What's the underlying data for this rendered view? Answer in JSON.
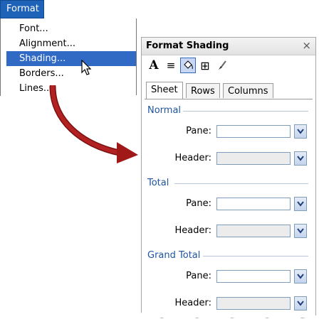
{
  "menu": {
    "title": "Format",
    "items": [
      {
        "label": "Font..."
      },
      {
        "label": "Alignment..."
      },
      {
        "label": "Shading..."
      },
      {
        "label": "Borders..."
      },
      {
        "label": "Lines..."
      }
    ],
    "selected": "Shading..."
  },
  "panel": {
    "title": "Format Shading",
    "close_glyph": "×",
    "toolbar": [
      {
        "icon": "font-icon",
        "glyph": "A"
      },
      {
        "icon": "align-icon",
        "glyph": "≡"
      },
      {
        "icon": "paint-bucket-icon",
        "glyph": "bucket",
        "selected": true
      },
      {
        "icon": "borders-icon",
        "glyph": "⊞"
      },
      {
        "icon": "brush-icon",
        "glyph": "brush"
      }
    ],
    "tabs": [
      {
        "label": "Sheet",
        "active": true
      },
      {
        "label": "Rows"
      },
      {
        "label": "Columns"
      }
    ],
    "groups": [
      {
        "label": "Normal",
        "fields": [
          {
            "label": "Pane:",
            "value": ""
          },
          {
            "label": "Header:",
            "value": ""
          }
        ]
      },
      {
        "label": "Total",
        "fields": [
          {
            "label": "Pane:",
            "value": ""
          },
          {
            "label": "Header:",
            "value": ""
          }
        ]
      },
      {
        "label": "Grand Total",
        "fields": [
          {
            "label": "Pane:",
            "value": ""
          },
          {
            "label": "Header:",
            "value": ""
          }
        ]
      }
    ]
  },
  "colors": {
    "menu_highlight": "#316ac5",
    "menubar": "#1f63b8",
    "arrow": "#a01818",
    "group_label": "#1f55a0"
  }
}
